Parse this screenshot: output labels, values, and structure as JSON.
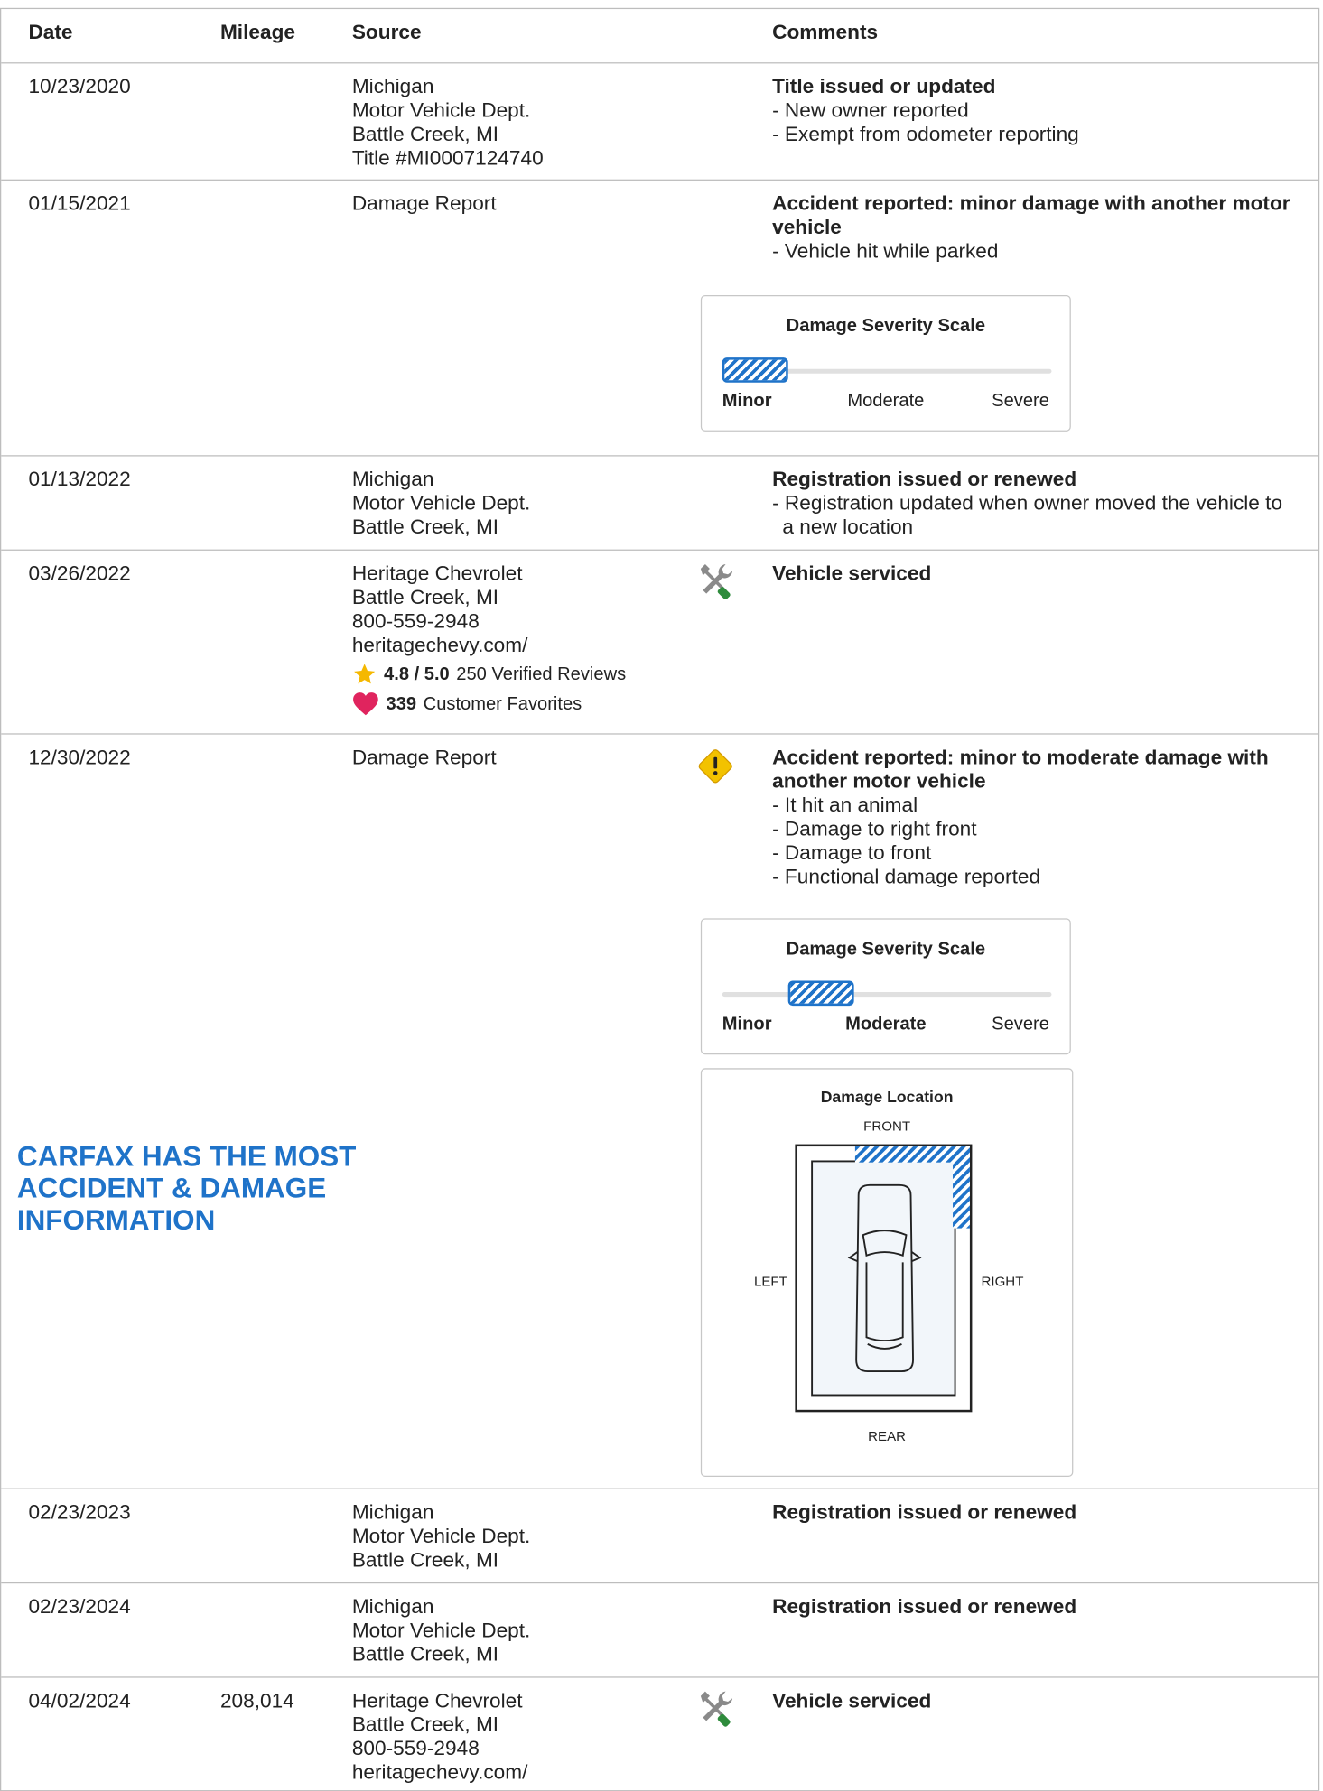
{
  "header": {
    "date": "Date",
    "mileage": "Mileage",
    "source": "Source",
    "comments": "Comments"
  },
  "rows": [
    {
      "date": "10/23/2020",
      "mileage": "",
      "source": [
        "Michigan",
        "Motor Vehicle Dept.",
        "Battle Creek, MI",
        "Title #MI0007124740"
      ],
      "title": "Title issued or updated",
      "bullets": [
        "New owner reported",
        "Exempt from odometer reporting"
      ]
    },
    {
      "date": "01/15/2021",
      "mileage": "",
      "source": [
        "Damage Report"
      ],
      "title": "Accident reported: minor damage with another motor vehicle",
      "bullets": [
        "Vehicle hit while parked"
      ],
      "severity": {
        "title": "Damage Severity Scale",
        "level": "Minor",
        "labels": [
          "Minor",
          "Moderate",
          "Severe"
        ]
      }
    },
    {
      "date": "01/13/2022",
      "mileage": "",
      "source": [
        "Michigan",
        "Motor Vehicle Dept.",
        "Battle Creek, MI"
      ],
      "title": "Registration issued or renewed",
      "bullets": [
        "Registration updated when owner moved the vehicle to a new location"
      ]
    },
    {
      "date": "03/26/2022",
      "mileage": "",
      "source": [
        "Heritage Chevrolet",
        "Battle Creek, MI",
        "800-559-2948",
        "heritagechevy.com/"
      ],
      "icon": "service-tools-icon",
      "title": "Vehicle serviced",
      "bullets": [],
      "rating": "4.8 / 5.0",
      "reviews": "250 Verified Reviews",
      "favorites_count": "339",
      "favorites_label": "Customer Favorites"
    },
    {
      "date": "12/30/2022",
      "mileage": "",
      "source": [
        "Damage Report"
      ],
      "icon": "warning-icon",
      "title": "Accident reported: minor to moderate damage with another motor vehicle",
      "bullets": [
        "It hit an animal",
        "Damage to right front",
        "Damage to front",
        "Functional damage reported"
      ],
      "severity": {
        "title": "Damage Severity Scale",
        "level": "Moderate",
        "labels": [
          "Minor",
          "Moderate",
          "Severe"
        ]
      },
      "location": {
        "title": "Damage Location",
        "front": "FRONT",
        "rear": "REAR",
        "left": "LEFT",
        "right": "RIGHT",
        "damaged_areas": [
          "front",
          "right-front"
        ]
      }
    },
    {
      "date": "02/23/2023",
      "mileage": "",
      "source": [
        "Michigan",
        "Motor Vehicle Dept.",
        "Battle Creek, MI"
      ],
      "title": "Registration issued or renewed",
      "bullets": []
    },
    {
      "date": "02/23/2024",
      "mileage": "",
      "source": [
        "Michigan",
        "Motor Vehicle Dept.",
        "Battle Creek, MI"
      ],
      "title": "Registration issued or renewed",
      "bullets": []
    },
    {
      "date": "04/02/2024",
      "mileage": "208,014",
      "source": [
        "Heritage Chevrolet",
        "Battle Creek, MI",
        "800-559-2948",
        "heritagechevy.com/"
      ],
      "icon": "service-tools-icon",
      "title": "Vehicle serviced",
      "bullets": []
    }
  ],
  "promo": [
    "CARFAX HAS THE MOST",
    "ACCIDENT & DAMAGE",
    "INFORMATION"
  ],
  "colors": {
    "accent": "#1f73c9",
    "border": "#bdbdbd",
    "star": "#f5b800",
    "heart": "#e0245e",
    "warning": "#f2c200",
    "wrench_green": "#2e8b3c"
  }
}
